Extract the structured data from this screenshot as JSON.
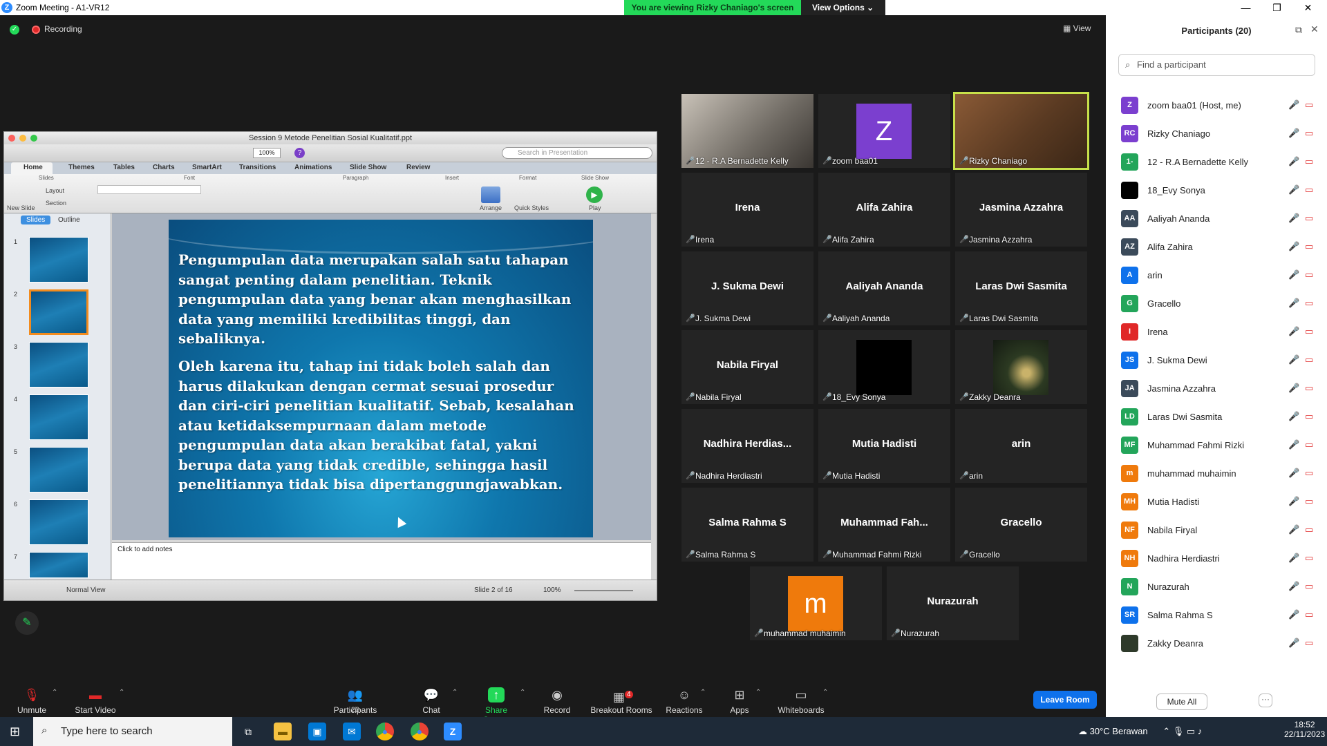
{
  "window": {
    "title": "Zoom Meeting - A1-VR12",
    "view_banner": "You are viewing Rizky Chaniago's screen",
    "view_options": "View Options",
    "minimize": "—",
    "maximize": "❐",
    "close": "✕"
  },
  "meeting": {
    "recording_label": "Recording",
    "view_label": "View"
  },
  "ppt": {
    "doc_title": "Session 9 Metode Penelitian Sosial Kualitatif.ppt",
    "zoom_value": "100%",
    "search_placeholder": "Search in Presentation",
    "ribbon_tabs": [
      "Home",
      "Themes",
      "Tables",
      "Charts",
      "SmartArt",
      "Transitions",
      "Animations",
      "Slide Show",
      "Review"
    ],
    "ribbon_groups": [
      "Slides",
      "Font",
      "Paragraph",
      "Insert",
      "Format",
      "Slide Show"
    ],
    "ribbon_buttons": {
      "new_slide": "New Slide",
      "layout": "Layout",
      "section": "Section",
      "arrange": "Arrange",
      "quick_styles": "Quick Styles",
      "play": "Play"
    },
    "thumb_tabs": {
      "slides": "Slides",
      "outline": "Outline"
    },
    "thumb_numbers": [
      "1",
      "2",
      "3",
      "4",
      "5",
      "6",
      "7"
    ],
    "slide_paragraph_1": "Pengumpulan data merupakan salah satu tahapan sangat penting dalam penelitian. Teknik pengumpulan data yang benar akan menghasilkan data yang memiliki kredibilitas tinggi, dan sebaliknya.",
    "slide_paragraph_2": "Oleh karena itu, tahap ini tidak boleh salah dan harus dilakukan dengan cermat sesuai prosedur dan ciri-ciri penelitian kualitatif. Sebab, kesalahan atau ketidaksempurnaan dalam metode pengumpulan data akan berakibat fatal, yakni berupa data yang tidak credible, sehingga hasil penelitiannya tidak bisa dipertanggungjawabkan.",
    "notes_placeholder": "Click to add notes",
    "status_view": "Normal View",
    "status_slide": "Slide 2 of 16",
    "status_zoom": "100%"
  },
  "tiles": [
    {
      "name": "12 - R.A Bernadette Kelly",
      "label": "",
      "type": "camera"
    },
    {
      "name": "zoom baa01",
      "label": "Z",
      "type": "avatar",
      "color": "#7b3fcf"
    },
    {
      "name": "Rizky Chaniago",
      "label": "",
      "type": "camera-active"
    },
    {
      "name": "Irena",
      "label": "Irena",
      "type": "text"
    },
    {
      "name": "Alifa Zahira",
      "label": "Alifa Zahira",
      "type": "text"
    },
    {
      "name": "Jasmina Azzahra",
      "label": "Jasmina Azzahra",
      "type": "text"
    },
    {
      "name": "J. Sukma Dewi",
      "label": "J. Sukma Dewi",
      "type": "text"
    },
    {
      "name": "Aaliyah Ananda",
      "label": "Aaliyah Ananda",
      "type": "text"
    },
    {
      "name": "Laras Dwi Sasmita",
      "label": "Laras Dwi Sasmita",
      "type": "text"
    },
    {
      "name": "Nabila Firyal",
      "label": "Nabila Firyal",
      "type": "text"
    },
    {
      "name": "18_Evy Sonya",
      "label": "",
      "type": "black"
    },
    {
      "name": "Zakky Deanra",
      "label": "",
      "type": "photo"
    },
    {
      "name": "Nadhira Herdiastri",
      "label": "Nadhira  Herdias...",
      "type": "text"
    },
    {
      "name": "Mutia Hadisti",
      "label": "Mutia Hadisti",
      "type": "text"
    },
    {
      "name": "arin",
      "label": "arin",
      "type": "text"
    },
    {
      "name": "Salma Rahma S",
      "label": "Salma Rahma S",
      "type": "text"
    },
    {
      "name": "Muhammad Fahmi Rizki",
      "label": "Muhammad  Fah...",
      "type": "text"
    },
    {
      "name": "Gracello",
      "label": "Gracello",
      "type": "text"
    },
    {
      "name": "muhammad muhaimin",
      "label": "m",
      "type": "avatar",
      "color": "#ef7a0c"
    },
    {
      "name": "Nurazurah",
      "label": "Nurazurah",
      "type": "text"
    }
  ],
  "toolbar": {
    "unmute": "Unmute",
    "start_video": "Start Video",
    "participants": "Participants",
    "participants_count": "20",
    "chat": "Chat",
    "share_screen": "Share Screen",
    "record": "Record",
    "breakout": "Breakout Rooms",
    "breakout_badge": "4",
    "reactions": "Reactions",
    "apps": "Apps",
    "whiteboards": "Whiteboards",
    "leave": "Leave Room"
  },
  "panel": {
    "title": "Participants (20)",
    "search_placeholder": "Find a participant",
    "mute_all": "Mute All",
    "more": "···",
    "participants": [
      {
        "initials": "Z",
        "name": "zoom baa01 (Host, me)",
        "color": "#7b3fcf"
      },
      {
        "initials": "RC",
        "name": "Rizky Chaniago",
        "color": "#7b3fcf"
      },
      {
        "initials": "1-",
        "name": "12 - R.A Bernadette Kelly",
        "color": "#23a55a"
      },
      {
        "initials": "",
        "name": "18_Evy Sonya",
        "color": "#000000"
      },
      {
        "initials": "AA",
        "name": "Aaliyah Ananda",
        "color": "#3b4a5a"
      },
      {
        "initials": "AZ",
        "name": "Alifa Zahira",
        "color": "#3b4a5a"
      },
      {
        "initials": "A",
        "name": "arin",
        "color": "#0e71eb"
      },
      {
        "initials": "G",
        "name": "Gracello",
        "color": "#23a55a"
      },
      {
        "initials": "I",
        "name": "Irena",
        "color": "#e02828"
      },
      {
        "initials": "JS",
        "name": "J. Sukma Dewi",
        "color": "#0e71eb"
      },
      {
        "initials": "JA",
        "name": "Jasmina Azzahra",
        "color": "#3b4a5a"
      },
      {
        "initials": "LD",
        "name": "Laras Dwi Sasmita",
        "color": "#23a55a"
      },
      {
        "initials": "MF",
        "name": "Muhammad Fahmi Rizki",
        "color": "#23a55a"
      },
      {
        "initials": "m",
        "name": "muhammad muhaimin",
        "color": "#ef7a0c"
      },
      {
        "initials": "MH",
        "name": "Mutia Hadisti",
        "color": "#ef7a0c"
      },
      {
        "initials": "NF",
        "name": "Nabila Firyal",
        "color": "#ef7a0c"
      },
      {
        "initials": "NH",
        "name": "Nadhira Herdiastri",
        "color": "#ef7a0c"
      },
      {
        "initials": "N",
        "name": "Nurazurah",
        "color": "#23a55a"
      },
      {
        "initials": "SR",
        "name": "Salma Rahma S",
        "color": "#0e71eb"
      },
      {
        "initials": "",
        "name": "Zakky Deanra",
        "color": "#2e3a2a"
      }
    ]
  },
  "taskbar": {
    "search_placeholder": "Type here to search",
    "weather": "30°C  Berawan",
    "time": "18:52",
    "date": "22/11/2023"
  }
}
